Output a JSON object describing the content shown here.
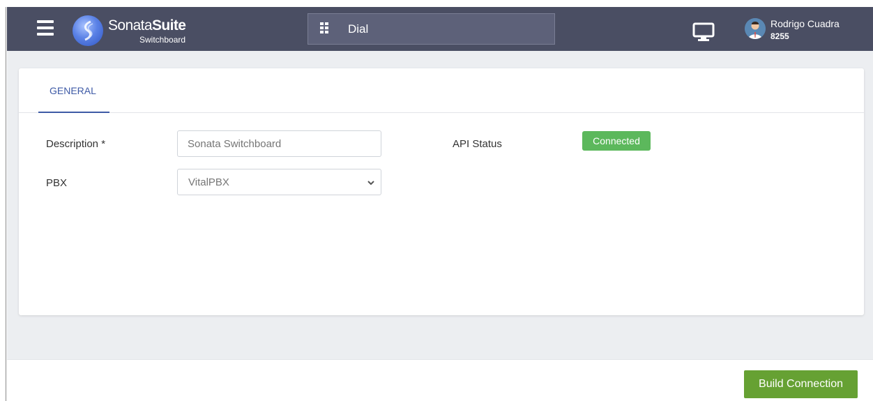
{
  "header": {
    "logo": {
      "brand_prefix": "Sonata",
      "brand_suffix": "Suite",
      "subtitle": "Switchboard"
    },
    "dial_label": "Dial",
    "user": {
      "name": "Rodrigo Cuadra",
      "extension": "8255"
    },
    "icons": [
      "hamburger-icon",
      "grid-icon",
      "monitor-icon",
      "user-avatar"
    ]
  },
  "tabs": [
    {
      "label": "GENERAL",
      "active": true
    }
  ],
  "form": {
    "description": {
      "label": "Description *",
      "placeholder": "Sonata Switchboard"
    },
    "pbx": {
      "label": "PBX",
      "value": "VitalPBX"
    },
    "api_status": {
      "label": "API Status",
      "value": "Connected"
    }
  },
  "actions": {
    "build_connection": "Build Connection"
  },
  "colors": {
    "topbar": "#4a4e63",
    "accent": "#3e5aa6",
    "status_connected": "#5cb85c",
    "primary_button": "#66a133"
  }
}
